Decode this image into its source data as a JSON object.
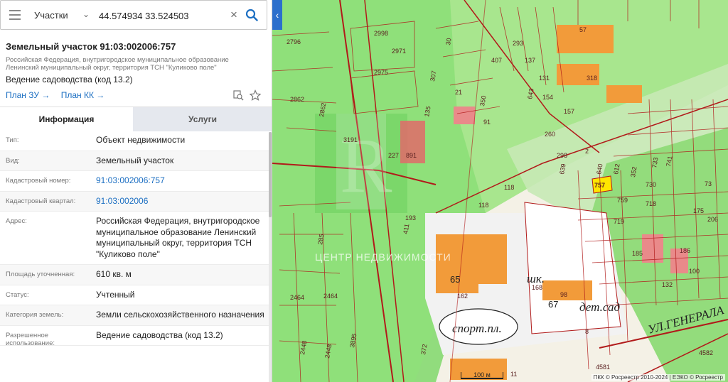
{
  "search": {
    "layer": "Участки",
    "query": "44.574934 33.524503"
  },
  "parcel": {
    "title": "Земельный участок 91:03:002006:757",
    "address_small": "Российская Федерация, внутригородское муниципальное образование Ленинский муниципальный округ, территория ТСН \"Куликово поле\"",
    "usage": "Ведение садоводства (код 13.2)",
    "plan_zu": "План ЗУ →",
    "plan_kk": "План КК →"
  },
  "tabs": {
    "info": "Информация",
    "services": "Услуги"
  },
  "info_rows": [
    {
      "label": "Тип:",
      "value": "Объект недвижимости"
    },
    {
      "label": "Вид:",
      "value": "Земельный участок"
    },
    {
      "label": "Кадастровый номер:",
      "value": "91:03:002006:757"
    },
    {
      "label": "Кадастровый квартал:",
      "value": "91:03:002006"
    },
    {
      "label": "Адрес:",
      "value": "Российская Федерация, внутригородское муниципальное образование Ленинский муниципальный округ, территория ТСН \"Куликово поле\""
    },
    {
      "label": "Площадь уточненная:",
      "value": "610 кв. м"
    },
    {
      "label": "Статус:",
      "value": "Учтенный"
    },
    {
      "label": "Категория земель:",
      "value": "Земли сельскохозяйственного назначения"
    },
    {
      "label": "Разрешенное использование:",
      "value": "Ведение садоводства (код 13.2)"
    }
  ],
  "map": {
    "scale": "100 м",
    "attribution": "ПКК © Росреестр 2010-2024 | ЕЭКО © Росреестр",
    "watermark": "ЦЕНТР НЕДВИЖИМОСТИ",
    "labels": {
      "sport": "спорт.пл.",
      "school": "шк.",
      "kindergarten": "дет.сад",
      "street": "УЛ.ГЕНЕРАЛА",
      "n65": "65",
      "n67": "67",
      "selected": "757"
    },
    "plot_numbers": [
      "2998",
      "2971",
      "2975",
      "2796",
      "2862",
      "2862",
      "3191",
      "227",
      "891",
      "193",
      "411",
      "118",
      "118",
      "285",
      "2464",
      "2464",
      "2448",
      "2448",
      "3895",
      "372",
      "162",
      "168",
      "98",
      "8",
      "57",
      "318",
      "407",
      "293",
      "137",
      "135",
      "21",
      "350",
      "91",
      "307",
      "30",
      "643",
      "131",
      "154",
      "157",
      "260",
      "298",
      "2",
      "639",
      "640",
      "612",
      "352",
      "733",
      "741",
      "759",
      "730",
      "719",
      "718",
      "206",
      "186",
      "175",
      "185",
      "132",
      "100",
      "73",
      "11",
      "4581",
      "4582"
    ],
    "colors": {
      "green_fill": "#8fe07a",
      "boundary": "#b11a1a",
      "building": "#f29b3a",
      "selected": "#ffe600"
    }
  }
}
